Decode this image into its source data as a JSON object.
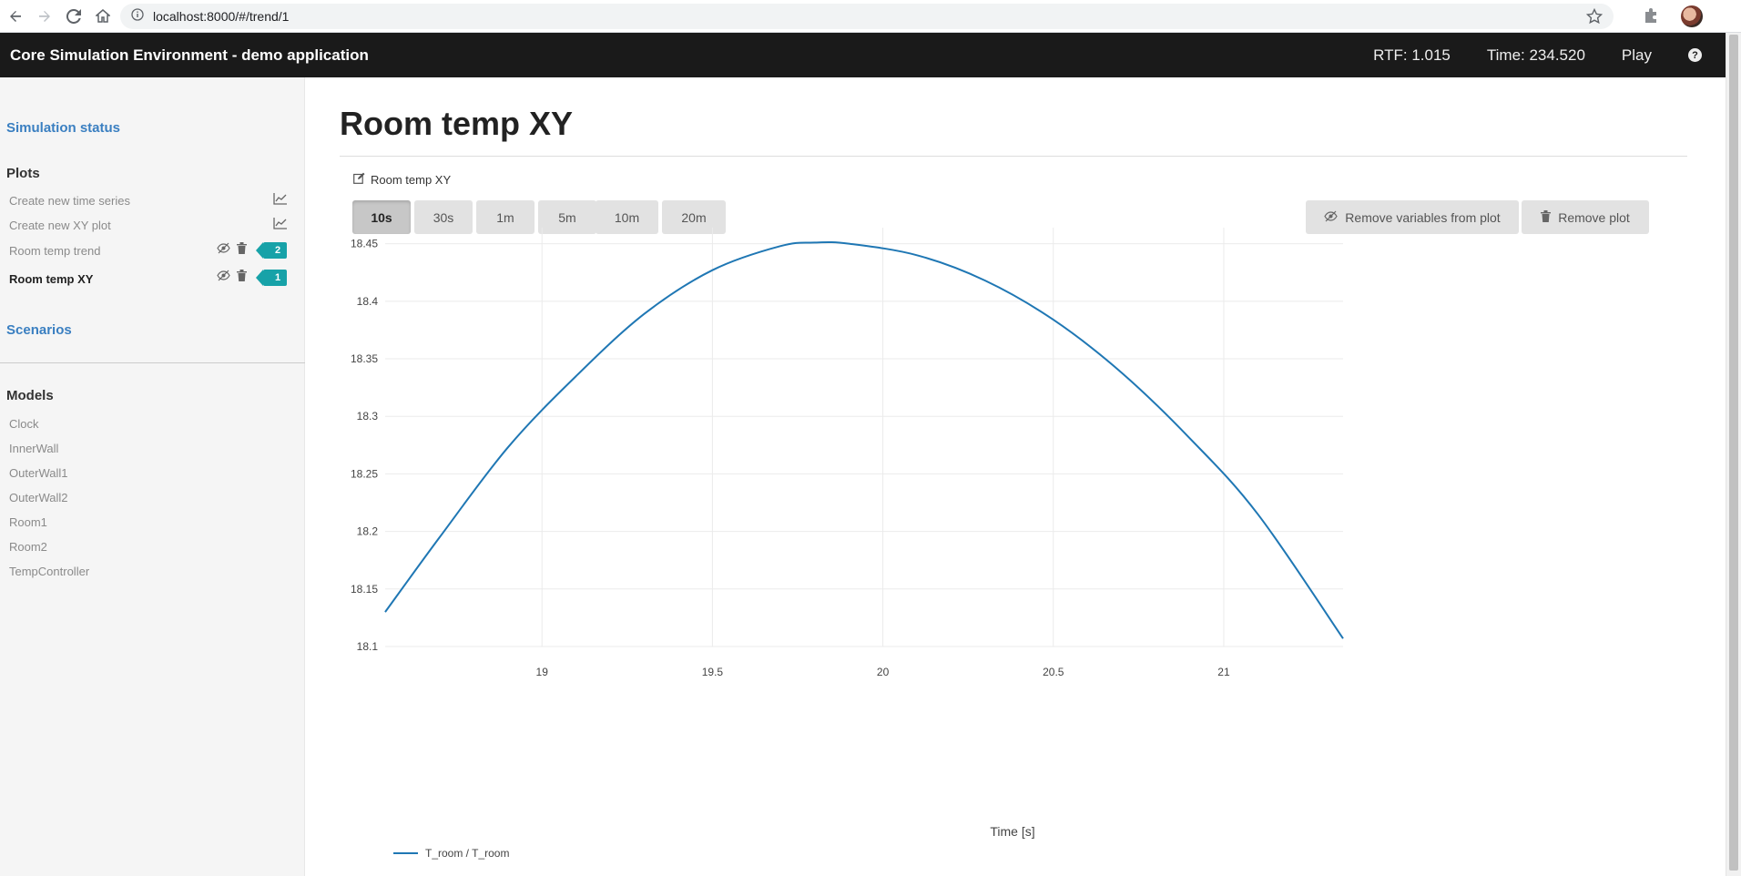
{
  "browser": {
    "url": "localhost:8000/#/trend/1"
  },
  "navbar": {
    "brand": "Core Simulation Environment - demo application",
    "rtf": "RTF: 1.015",
    "time": "Time: 234.520",
    "play": "Play",
    "help": "?"
  },
  "sidebar": {
    "simulation_status": "Simulation status",
    "plots_heading": "Plots",
    "plot_actions": [
      {
        "label": "Create new time series",
        "icon": "line-chart-icon"
      },
      {
        "label": "Create new XY plot",
        "icon": "line-chart-icon"
      }
    ],
    "plots": [
      {
        "label": "Room temp trend",
        "badge": "2",
        "active": false
      },
      {
        "label": "Room temp XY",
        "badge": "1",
        "active": true
      }
    ],
    "scenarios": "Scenarios",
    "models_heading": "Models",
    "models": [
      "Clock",
      "InnerWall",
      "OuterWall1",
      "OuterWall2",
      "Room1",
      "Room2",
      "TempController"
    ]
  },
  "main": {
    "title": "Room temp XY",
    "plot_name": "Room temp XY",
    "ranges": [
      {
        "label": "10s",
        "active": true
      },
      {
        "label": "30s",
        "active": false
      },
      {
        "label": "1m",
        "active": false
      },
      {
        "label": "5m",
        "active": false
      },
      {
        "label": "10m",
        "active": false
      },
      {
        "label": "20m",
        "active": false
      }
    ],
    "remove_variables_label": "Remove variables from plot",
    "remove_plot_label": "Remove plot"
  },
  "colors": {
    "series": "#1f77b4",
    "badge": "#17a2a8",
    "link": "#3a7fc1"
  },
  "chart_data": {
    "type": "line",
    "xlabel": "Time [s]",
    "ylabel": "",
    "xlim": [
      18.54,
      21.35
    ],
    "ylim": [
      18.1,
      18.46
    ],
    "x_ticks": [
      19,
      19.5,
      20,
      20.5,
      21
    ],
    "y_ticks": [
      18.1,
      18.15,
      18.2,
      18.25,
      18.3,
      18.35,
      18.4,
      18.45
    ],
    "x_tick_labels": [
      "19",
      "19.5",
      "20",
      "20.5",
      "21"
    ],
    "y_tick_labels": [
      "18.1",
      "18.15",
      "18.2",
      "18.25",
      "18.3",
      "18.35",
      "18.4",
      "18.45"
    ],
    "grid": true,
    "legend": "bottom-left",
    "series": [
      {
        "name": "T_room / T_room",
        "x": [
          18.54,
          18.7,
          18.9,
          19.1,
          19.3,
          19.5,
          19.7,
          19.8,
          19.9,
          20.1,
          20.3,
          20.5,
          20.7,
          20.9,
          21.1,
          21.35
        ],
        "y": [
          18.13,
          18.195,
          18.273,
          18.335,
          18.389,
          18.427,
          18.448,
          18.451,
          18.45,
          18.44,
          18.418,
          18.384,
          18.338,
          18.281,
          18.215,
          18.107
        ]
      }
    ]
  }
}
